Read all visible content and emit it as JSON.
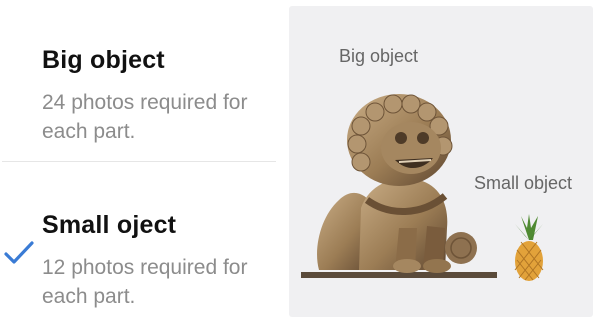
{
  "options": [
    {
      "title": "Big object",
      "description": "24 photos required for each part.",
      "selected": false
    },
    {
      "title": "Small oject",
      "description": "12 photos required for each part.",
      "selected": true
    }
  ],
  "preview": {
    "big_label": "Big object",
    "small_label": "Small object"
  },
  "icons": {
    "selected": "checkmark-icon",
    "big_object_image": "stone-lion-statue",
    "small_object_image": "pineapple"
  },
  "colors": {
    "accent": "#3a7bd5",
    "title": "#111111",
    "description": "#8c8c8c",
    "preview_bg": "#f0f0f2"
  }
}
